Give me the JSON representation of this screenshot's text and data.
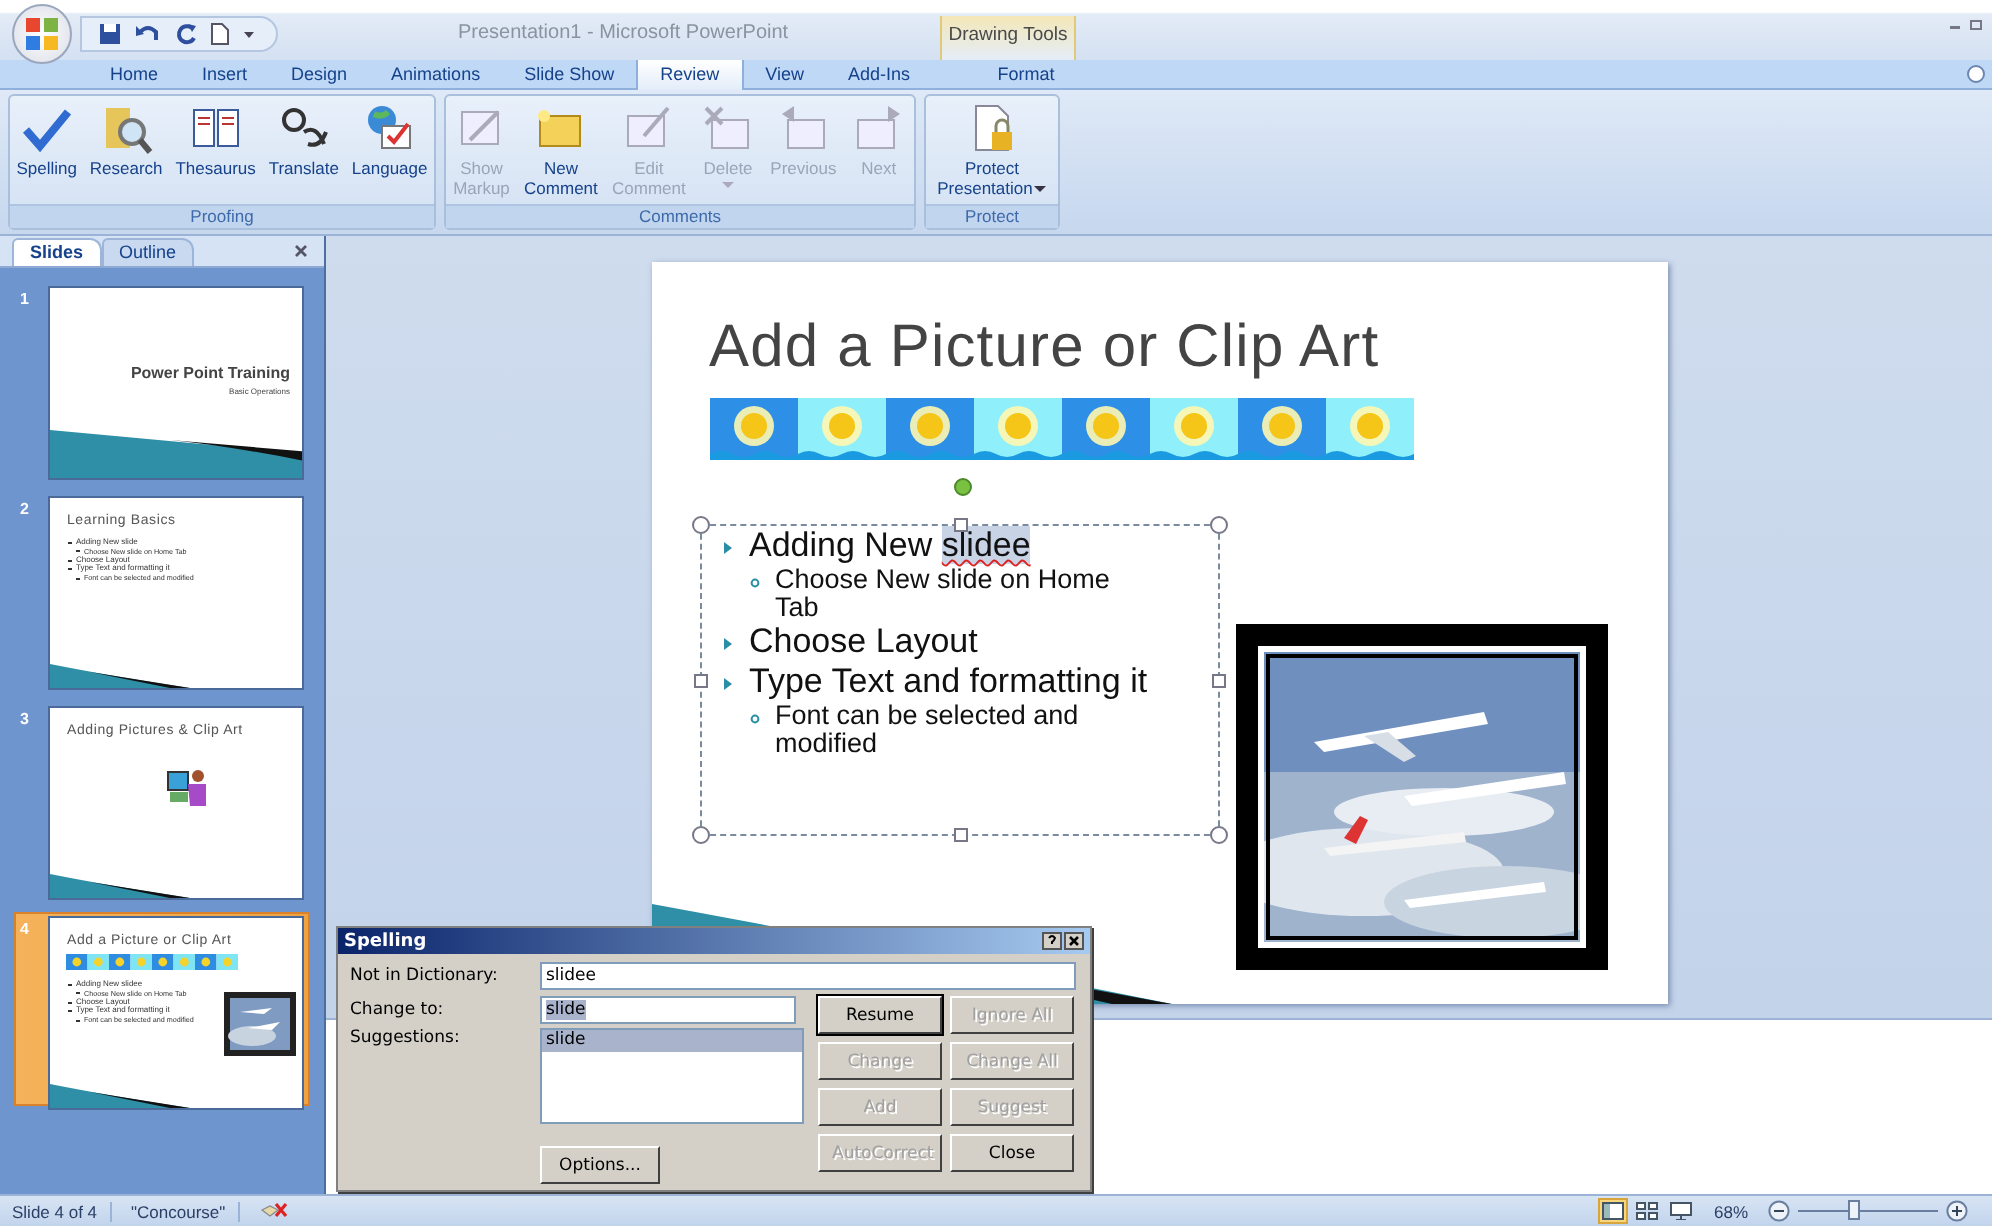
{
  "window": {
    "title": "Presentation1 - Microsoft PowerPoint",
    "contextual_group": "Drawing Tools"
  },
  "tabs": [
    {
      "label": "Home",
      "selected": false,
      "kind": "main"
    },
    {
      "label": "Insert",
      "selected": false,
      "kind": "main"
    },
    {
      "label": "Design",
      "selected": false,
      "kind": "main"
    },
    {
      "label": "Animations",
      "selected": false,
      "kind": "main"
    },
    {
      "label": "Slide Show",
      "selected": false,
      "kind": "main"
    },
    {
      "label": "Review",
      "selected": true,
      "kind": "main"
    },
    {
      "label": "View",
      "selected": false,
      "kind": "main"
    },
    {
      "label": "Add-Ins",
      "selected": false,
      "kind": "main"
    },
    {
      "label": "Format",
      "selected": false,
      "kind": "contextual"
    }
  ],
  "ribbon_groups": [
    {
      "label": "Proofing",
      "buttons": [
        {
          "kind": "spelling",
          "lines": [
            "Spelling"
          ],
          "disabled": false,
          "dropdown": false
        },
        {
          "kind": "research",
          "lines": [
            "Research"
          ],
          "disabled": false,
          "dropdown": false
        },
        {
          "kind": "thesaurus",
          "lines": [
            "Thesaurus"
          ],
          "disabled": false,
          "dropdown": false
        },
        {
          "kind": "translate",
          "lines": [
            "Translate"
          ],
          "disabled": false,
          "dropdown": false
        },
        {
          "kind": "language",
          "lines": [
            "Language"
          ],
          "disabled": false,
          "dropdown": false
        }
      ]
    },
    {
      "label": "Comments",
      "buttons": [
        {
          "kind": "markup",
          "lines": [
            "Show",
            "Markup"
          ],
          "disabled": true,
          "dropdown": false
        },
        {
          "kind": "new-comment",
          "lines": [
            "New",
            "Comment"
          ],
          "disabled": false,
          "dropdown": false
        },
        {
          "kind": "edit-comment",
          "lines": [
            "Edit",
            "Comment"
          ],
          "disabled": true,
          "dropdown": false
        },
        {
          "kind": "delete",
          "lines": [
            "Delete"
          ],
          "disabled": true,
          "dropdown": true
        },
        {
          "kind": "previous",
          "lines": [
            "Previous"
          ],
          "disabled": true,
          "dropdown": false
        },
        {
          "kind": "next",
          "lines": [
            "Next"
          ],
          "disabled": true,
          "dropdown": false
        }
      ]
    },
    {
      "label": "Protect",
      "buttons": [
        {
          "kind": "protect",
          "lines": [
            "Protect",
            "Presentation"
          ],
          "disabled": false,
          "dropdown": true
        }
      ]
    }
  ],
  "slides_pane": {
    "tabs": [
      {
        "label": "Slides",
        "selected": true
      },
      {
        "label": "Outline",
        "selected": false
      }
    ],
    "thumbnails": [
      {
        "number": "1",
        "selected": false,
        "kind": "title",
        "title": "Power Point Training",
        "subtitle": "Basic Operations"
      },
      {
        "number": "2",
        "selected": false,
        "kind": "bullets",
        "title": "Learning Basics",
        "bullets": [
          {
            "text": "Adding New slide",
            "children": [
              {
                "text": "Choose New slide on Home Tab"
              }
            ]
          },
          {
            "text": "Choose Layout"
          },
          {
            "text": "Type Text and formatting it",
            "children": [
              {
                "text": "Font can be selected and modified"
              }
            ]
          }
        ]
      },
      {
        "number": "3",
        "selected": false,
        "kind": "clipart",
        "title": "Adding Pictures & Clip Art"
      },
      {
        "number": "4",
        "selected": true,
        "kind": "picture",
        "title": "Add a Picture or Clip Art",
        "bullets": [
          {
            "text": "Adding New slidee",
            "children": [
              {
                "text": "Choose New slide on Home Tab"
              }
            ]
          },
          {
            "text": "Choose Layout"
          },
          {
            "text": "Type Text and formatting it",
            "children": [
              {
                "text": "Font can be selected and modified"
              }
            ]
          }
        ]
      }
    ]
  },
  "slide": {
    "title": "Add a Picture or Clip Art",
    "bullets": [
      {
        "segments": [
          {
            "text": "Adding New ",
            "misspelled": false
          },
          {
            "text": "slidee",
            "misspelled": true
          }
        ],
        "children": [
          {
            "segments": [
              {
                "text": "Choose New slide on Home Tab",
                "misspelled": false
              }
            ]
          }
        ]
      },
      {
        "segments": [
          {
            "text": "Choose Layout",
            "misspelled": false
          }
        ]
      },
      {
        "segments": [
          {
            "text": "Type Text and formatting it",
            "misspelled": false
          }
        ],
        "children": [
          {
            "segments": [
              {
                "text": "Font can be selected and modified",
                "misspelled": false
              }
            ]
          }
        ]
      }
    ]
  },
  "spelling_dialog": {
    "title": "Spelling",
    "not_in_dictionary_label": "Not in Dictionary:",
    "not_in_dictionary": "slidee",
    "change_to_label": "Change to:",
    "change_to": "slide",
    "suggestions_label": "Suggestions:",
    "suggestions": [
      {
        "text": "slide",
        "selected": true
      }
    ],
    "options_button": "Options...",
    "buttons": [
      {
        "label": "Resume",
        "disabled": false,
        "default": true
      },
      {
        "label": "Ignore All",
        "disabled": true,
        "default": false
      },
      {
        "label": "Change",
        "disabled": true,
        "default": false
      },
      {
        "label": "Change All",
        "disabled": true,
        "default": false
      },
      {
        "label": "Add",
        "disabled": true,
        "default": false
      },
      {
        "label": "Suggest",
        "disabled": true,
        "default": false
      },
      {
        "label": "AutoCorrect",
        "disabled": true,
        "default": false
      },
      {
        "label": "Close",
        "disabled": false,
        "default": false
      }
    ]
  },
  "status_bar": {
    "slide_info": "Slide 4 of 4",
    "theme": "\"Concourse\"",
    "views": [
      {
        "kind": "normal",
        "selected": true
      },
      {
        "kind": "sorter",
        "selected": false
      },
      {
        "kind": "show",
        "selected": false
      }
    ],
    "zoom": "68%",
    "zoom_slider": {
      "level": 0.4
    }
  }
}
